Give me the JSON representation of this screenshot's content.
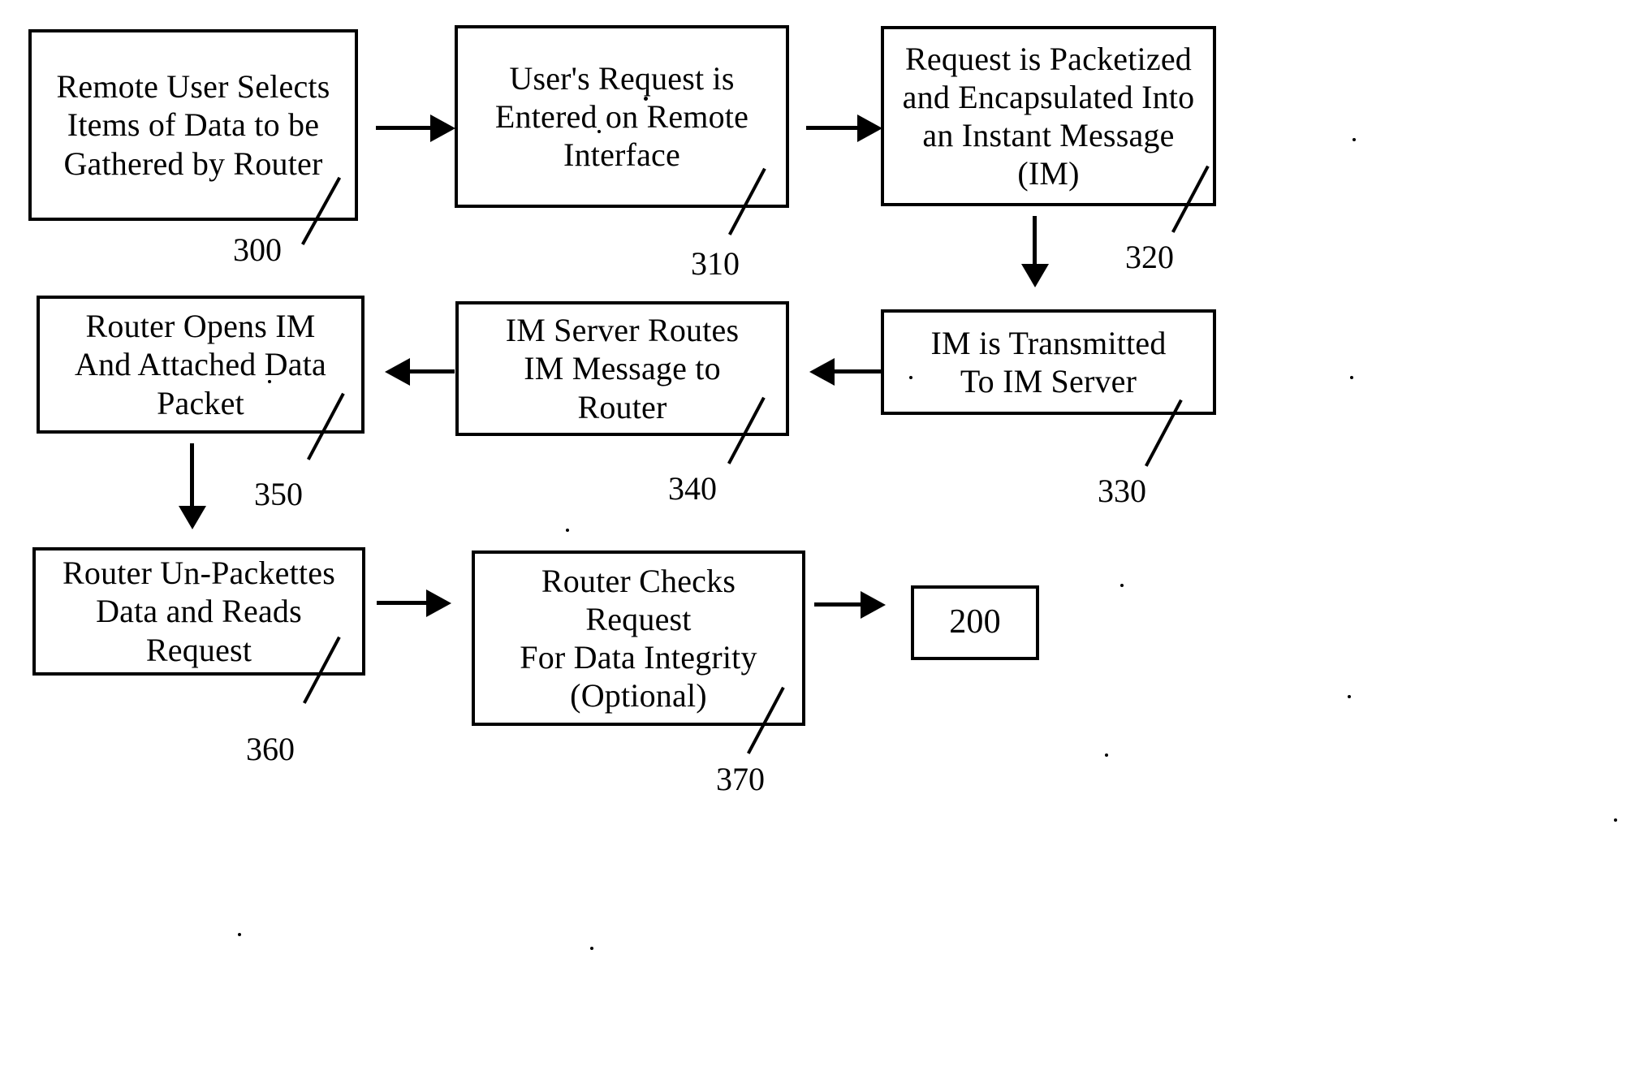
{
  "figure": {
    "type": "patent-flowchart",
    "background_color": "#ffffff",
    "line_color": "#000000"
  },
  "nodes": [
    {
      "id": "300",
      "ref": "300",
      "text": "Remote User Selects\nItems of Data to be\nGathered by Router"
    },
    {
      "id": "310",
      "ref": "310",
      "text": "User's Request is\nEntered on Remote\nInterface"
    },
    {
      "id": "320",
      "ref": "320",
      "text": "Request is Packetized\nand Encapsulated Into\nan Instant Message\n(IM)"
    },
    {
      "id": "330",
      "ref": "330",
      "text": "IM is Transmitted\nTo IM Server"
    },
    {
      "id": "340",
      "ref": "340",
      "text": "IM Server Routes\nIM Message to\nRouter"
    },
    {
      "id": "350",
      "ref": "350",
      "text": "Router Opens IM\nAnd Attached Data\nPacket"
    },
    {
      "id": "360",
      "ref": "360",
      "text": "Router Un-Packettes\nData and Reads\nRequest"
    },
    {
      "id": "370",
      "ref": "370",
      "text": "Router Checks\nRequest\nFor Data Integrity\n(Optional)"
    },
    {
      "id": "200",
      "ref": "",
      "text": "200"
    }
  ],
  "connectors": [
    {
      "name": "arrow-300-to-310",
      "direction": "right"
    },
    {
      "name": "arrow-310-to-320",
      "direction": "right"
    },
    {
      "name": "arrow-320-to-330",
      "direction": "down"
    },
    {
      "name": "arrow-330-to-340",
      "direction": "left"
    },
    {
      "name": "arrow-340-to-350",
      "direction": "left"
    },
    {
      "name": "arrow-350-to-360",
      "direction": "down"
    },
    {
      "name": "arrow-360-to-370",
      "direction": "right"
    },
    {
      "name": "arrow-370-to-200",
      "direction": "right"
    }
  ]
}
